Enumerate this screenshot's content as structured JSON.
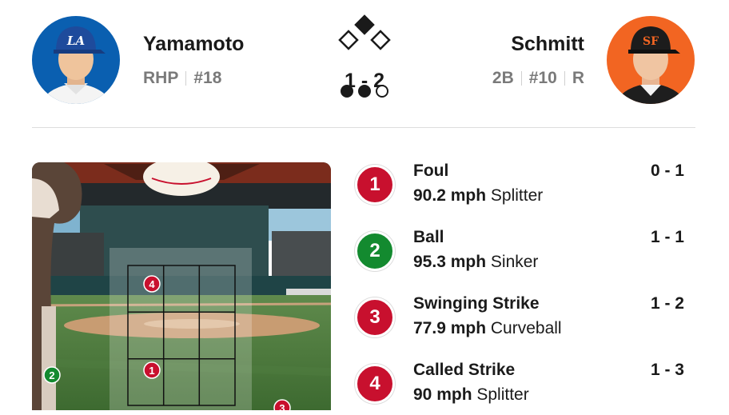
{
  "pitcher": {
    "name": "Yamamoto",
    "position": "RHP",
    "number": "#18",
    "team_cap_logo": "LA"
  },
  "batter": {
    "name": "Schmitt",
    "position": "2B",
    "number": "#10",
    "bats": "R",
    "team_cap_logo": "SF"
  },
  "game_state": {
    "count": "1 - 2",
    "bases": {
      "first": false,
      "second": true,
      "third": false
    },
    "outs": 2,
    "outs_max": 3
  },
  "strike_zone": {
    "markers": [
      {
        "label": "4",
        "result": "strike"
      },
      {
        "label": "1",
        "result": "strike"
      },
      {
        "label": "2",
        "result": "ball"
      },
      {
        "label": "3",
        "result": "strike"
      }
    ]
  },
  "colors": {
    "strike": "#c8102e",
    "ball": "#138a2f"
  },
  "plays": [
    {
      "number": "1",
      "result": "Foul",
      "speed": "90.2 mph",
      "pitch_type": "Splitter",
      "count": "0 - 1",
      "kind": "strike"
    },
    {
      "number": "2",
      "result": "Ball",
      "speed": "95.3 mph",
      "pitch_type": "Sinker",
      "count": "1 - 1",
      "kind": "ball"
    },
    {
      "number": "3",
      "result": "Swinging Strike",
      "speed": "77.9 mph",
      "pitch_type": "Curveball",
      "count": "1 - 2",
      "kind": "strike"
    },
    {
      "number": "4",
      "result": "Called Strike",
      "speed": "90 mph",
      "pitch_type": "Splitter",
      "count": "1 - 3",
      "kind": "strike"
    }
  ]
}
